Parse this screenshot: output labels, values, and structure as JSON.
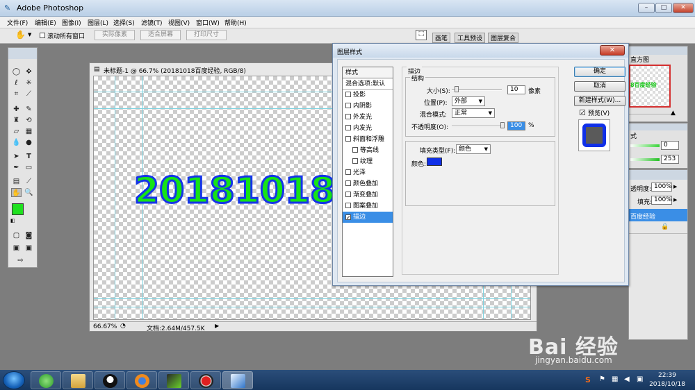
{
  "app": {
    "title": "Adobe Photoshop"
  },
  "window_controls": {
    "minimize": "–",
    "maximize": "□",
    "close": "✕"
  },
  "menu": [
    "文件(F)",
    "编辑(E)",
    "图像(I)",
    "图层(L)",
    "选择(S)",
    "滤镜(T)",
    "视图(V)",
    "窗口(W)",
    "帮助(H)"
  ],
  "options_bar": {
    "scroll_all_label": "滚动所有窗口",
    "actual_pixels": "实际像素",
    "fit_screen": "适合屏幕",
    "print_size": "打印尺寸",
    "tabs": [
      "画笔",
      "工具预设",
      "图层复合"
    ]
  },
  "document": {
    "title": "未标题-1 @ 66.7% (20181018百度经验, RGB/8)",
    "canvas_text": "20181018百度经验",
    "zoom": "66.67%",
    "doc_info": "文档:2.64M/457.5K"
  },
  "dialog": {
    "title": "图层样式",
    "close": "✕",
    "styles_header": "样式",
    "blend_options": "混合选项:默认",
    "effects": [
      {
        "label": "投影",
        "checked": false,
        "indent": false
      },
      {
        "label": "内阴影",
        "checked": false,
        "indent": false
      },
      {
        "label": "外发光",
        "checked": false,
        "indent": false
      },
      {
        "label": "内发光",
        "checked": false,
        "indent": false
      },
      {
        "label": "斜面和浮雕",
        "checked": false,
        "indent": false
      },
      {
        "label": "等高线",
        "checked": false,
        "indent": true
      },
      {
        "label": "纹理",
        "checked": false,
        "indent": true
      },
      {
        "label": "光泽",
        "checked": false,
        "indent": false
      },
      {
        "label": "颜色叠加",
        "checked": false,
        "indent": false
      },
      {
        "label": "渐变叠加",
        "checked": false,
        "indent": false
      },
      {
        "label": "图案叠加",
        "checked": false,
        "indent": false
      },
      {
        "label": "描边",
        "checked": true,
        "indent": false,
        "selected": true
      }
    ],
    "stroke": {
      "section": "描边",
      "structure": "结构",
      "size_label": "大小(S):",
      "size_value": "10",
      "size_unit": "像素",
      "position_label": "位置(P):",
      "position_value": "外部",
      "blend_label": "混合模式:",
      "blend_value": "正常",
      "opacity_label": "不透明度(O):",
      "opacity_value": "100",
      "opacity_unit": "%",
      "fill_type_label": "填充类型(F):",
      "fill_type_value": "颜色",
      "color_label": "颜色:",
      "color": "#1030e8"
    },
    "buttons": {
      "ok": "确定",
      "cancel": "取消",
      "new_style": "新建样式(W)...",
      "preview": "预览(V)"
    }
  },
  "panels": {
    "navigator_tab": "直方图",
    "nav_preview_text": "8百度经验",
    "styles_hint": "式",
    "value_0": "0",
    "value_253": "253",
    "layers": {
      "opacity_label": "透明度:",
      "opacity_value": "100%",
      "fill_label": "填充:",
      "fill_value": "100%",
      "layer_name": "百度经验"
    }
  },
  "toolbox": {
    "foreground": "#1fe11f",
    "background": "#ffffff"
  },
  "taskbar": {
    "time": "22:39",
    "date": "2018/10/18"
  },
  "watermark": {
    "logo": "Bai 经验",
    "url": "jingyan.baidu.com"
  }
}
